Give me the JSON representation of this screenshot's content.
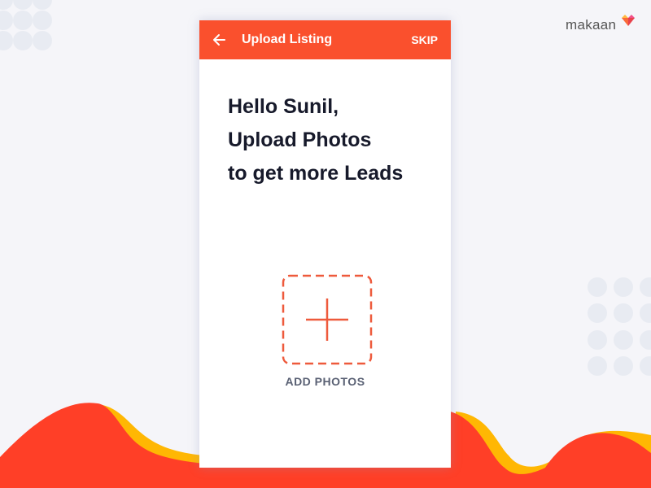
{
  "brand": {
    "logo_text": "makaan",
    "accent_color": "#fa502d",
    "wave_red": "#ff3f27",
    "wave_yellow": "#ffb703"
  },
  "appbar": {
    "back_icon": "arrow-left-icon",
    "title": "Upload Listing",
    "skip_label": "SKIP"
  },
  "greeting": {
    "line1": "Hello Sunil,",
    "line2": "Upload Photos",
    "line3": "to get more Leads"
  },
  "add_photos": {
    "icon": "plus-icon",
    "label": "ADD PHOTOS"
  }
}
